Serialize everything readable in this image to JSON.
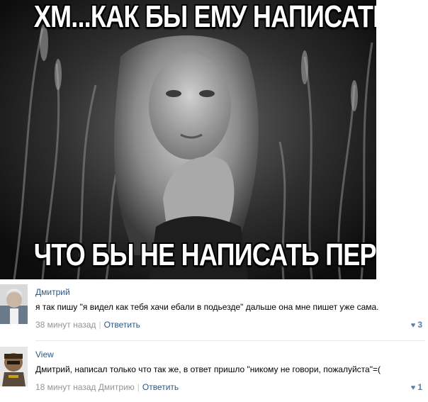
{
  "meme": {
    "top_caption": "ХМ...КАК БЫ ЕМУ НАПИСАТЬ ТАК",
    "bottom_caption": "ЧТО БЫ НЕ НАПИСАТЬ ПЕРВОЙ"
  },
  "comments": [
    {
      "author": "Дмитрий",
      "text": "я так пишу \"я видел как тебя хачи ебали в подьезде\" дальше она мне пишет уже сама.",
      "time": "38 минут назад",
      "reply_to": "",
      "reply_label": "Ответить",
      "likes": "3"
    },
    {
      "author": "View",
      "text": "Дмитрий, написал только что так же, в ответ пришло \"никому не говори, пожалуйста\"=(",
      "time": "18 минут назад",
      "reply_to": "Дмитрию",
      "reply_label": "Ответить",
      "likes": "1"
    }
  ],
  "icons": {
    "like": "heart-icon"
  },
  "colors": {
    "link": "#2a5885",
    "meta": "#939393",
    "like": "#5b7fa6"
  }
}
